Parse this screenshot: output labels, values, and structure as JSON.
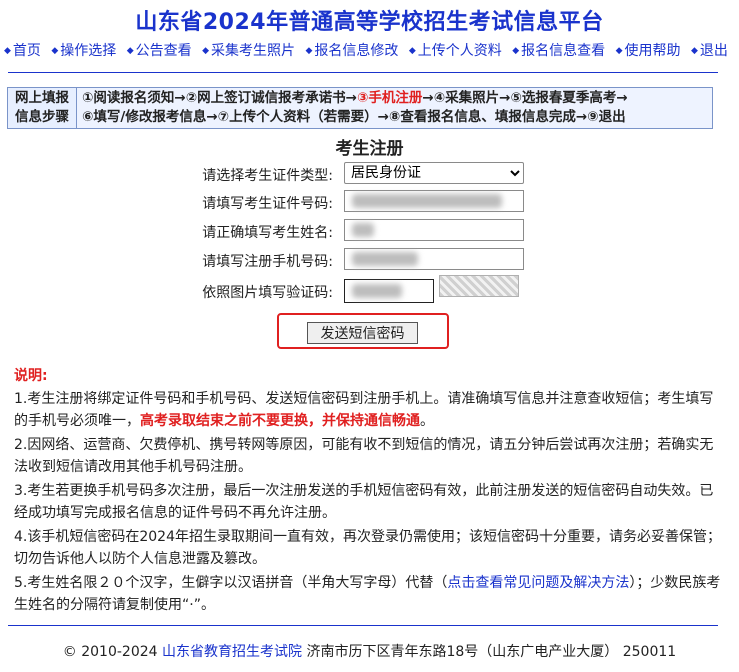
{
  "header": {
    "title": "山东省2024年普通高等学校招生考试信息平台",
    "nav": [
      "首页",
      "操作选择",
      "公告查看",
      "采集考生照片",
      "报名信息修改",
      "上传个人资料",
      "报名信息查看",
      "使用帮助",
      "退出"
    ]
  },
  "steps": {
    "label_line1": "网上填报",
    "label_line2": "信息步骤",
    "line1_before": "①阅读报名须知→②网上签订诚信报考承诺书→",
    "line1_current": "③手机注册",
    "line1_after": "→④采集照片→⑤选报春夏季高考→",
    "line2": "⑥填写/修改报考信息→⑦上传个人资料（若需要）→⑧查看报名信息、填报信息完成→⑨退出"
  },
  "form": {
    "title": "考生注册",
    "id_type_label": "请选择考生证件类型:",
    "id_type_value": "居民身份证",
    "id_number_label": "请填写考生证件号码:",
    "name_label": "请正确填写考生姓名:",
    "phone_label": "请填写注册手机号码:",
    "captcha_label": "依照图片填写验证码:",
    "send_button": "发送短信密码"
  },
  "notes": {
    "heading": "说明:",
    "n1_text": "1.考生注册将绑定证件号码和手机号码、发送短信密码到注册手机上。请准确填写信息并注意查收短信；考生填写的手机号必须唯一，",
    "n1_red": "高考录取结束之前不要更换，并保持通信畅通",
    "n1_end": "。",
    "n2": "2.因网络、运营商、欠费停机、携号转网等原因，可能有收不到短信的情况，请五分钟后尝试再次注册；若确实无法收到短信请改用其他手机号码注册。",
    "n3": "3.考生若更换手机号码多次注册，最后一次注册发送的手机短信密码有效，此前注册发送的短信密码自动失效。已经成功填写完成报名信息的证件号码不再允许注册。",
    "n4": "4.该手机短信密码在2024年招生录取期间一直有效，再次登录仍需使用；该短信密码十分重要，请务必妥善保管；切勿告诉他人以防个人信息泄露及篡改。",
    "n5_text": "5.考生姓名限２０个汉字，生僻字以汉语拼音（半角大写字母）代替（",
    "n5_link": "点击查看常见问题及解决方法",
    "n5_end": "）；少数民族考生姓名的分隔符请复制使用“·”。"
  },
  "footer": {
    "copyright": "© 2010-2024 ",
    "org_link": "山东省教育招生考试院",
    "address": " 济南市历下区青年东路18号（山东广电产业大厦） 250011"
  }
}
